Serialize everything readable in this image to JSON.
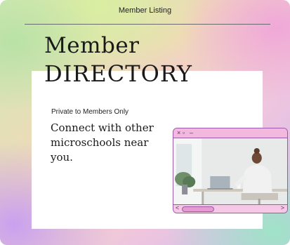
{
  "header": {
    "label": "Member Listing"
  },
  "hero": {
    "title_line1": "Member",
    "title_line2": "DIRECTORY",
    "tagline": "Private to Members Only",
    "lead_text": "Connect with other microschools near you."
  },
  "mock_window": {
    "controls": [
      "×",
      "▫",
      "–"
    ],
    "scroll_left": "<",
    "scroll_right": ">",
    "photo_icon": "person-at-laptop-photo"
  },
  "colors": {
    "frame_border": "#9a5aa8",
    "frame_fill": "#f5c9e6",
    "text": "#1a1a1a"
  }
}
